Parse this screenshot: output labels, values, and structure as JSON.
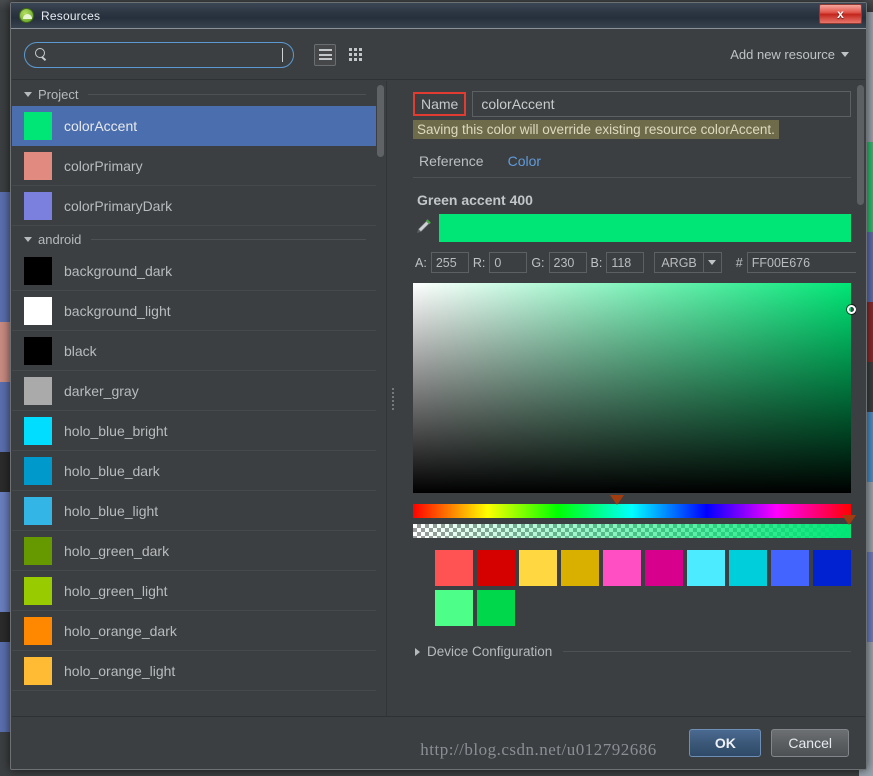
{
  "window": {
    "title": "Resources",
    "app_icon": "android-studio-icon",
    "close_label": "x"
  },
  "toolbar": {
    "search_value": "",
    "search_placeholder": "",
    "list_view_label": "list-view",
    "grid_view_label": "grid-view",
    "add_resource_label": "Add new resource"
  },
  "left_pane": {
    "groups": [
      {
        "title": "Project",
        "items": [
          {
            "label": "colorAccent",
            "color": "#00E676",
            "selected": true
          },
          {
            "label": "colorPrimary",
            "color": "#E08A80",
            "selected": false
          },
          {
            "label": "colorPrimaryDark",
            "color": "#7B7FDD",
            "selected": false
          }
        ]
      },
      {
        "title": "android",
        "items": [
          {
            "label": "background_dark",
            "color": "#000000",
            "selected": false
          },
          {
            "label": "background_light",
            "color": "#FFFFFF",
            "selected": false
          },
          {
            "label": "black",
            "color": "#000000",
            "selected": false
          },
          {
            "label": "darker_gray",
            "color": "#AAAAAA",
            "selected": false
          },
          {
            "label": "holo_blue_bright",
            "color": "#00DDFF",
            "selected": false
          },
          {
            "label": "holo_blue_dark",
            "color": "#0099CC",
            "selected": false
          },
          {
            "label": "holo_blue_light",
            "color": "#33B5E5",
            "selected": false
          },
          {
            "label": "holo_green_dark",
            "color": "#669900",
            "selected": false
          },
          {
            "label": "holo_green_light",
            "color": "#99CC00",
            "selected": false
          },
          {
            "label": "holo_orange_dark",
            "color": "#FF8800",
            "selected": false
          },
          {
            "label": "holo_orange_light",
            "color": "#FFBB33",
            "selected": false
          }
        ]
      }
    ]
  },
  "right_pane": {
    "name_label": "Name",
    "name_value": "colorAccent",
    "warning": "Saving this color will override existing resource colorAccent.",
    "tabs": [
      {
        "label": "Reference",
        "active": false
      },
      {
        "label": "Color",
        "active": true
      }
    ],
    "color_title": "Green accent 400",
    "pipette_icon": "eyedropper-icon",
    "preview_color": "#00E676",
    "channels": {
      "a_label": "A:",
      "a_value": "255",
      "r_label": "R:",
      "r_value": "0",
      "g_label": "G:",
      "g_value": "230",
      "b_label": "B:",
      "b_value": "118",
      "mode_value": "ARGB",
      "hash_label": "#",
      "hex_value": "FF00E676"
    },
    "sliders": {
      "hue_position_pct": 46.5,
      "alpha_position_pct": 99.5
    },
    "palette": [
      [
        "#FF5252",
        "#D50000",
        "#FFD740",
        "#D9AF00",
        "#FF4FC3",
        "#D6008C",
        "#4DEBFF",
        "#00CEDB",
        "#4364FF",
        "#0022D1"
      ],
      [
        "#4DFF88",
        "#00D74A"
      ]
    ],
    "device_configuration_label": "Device Configuration"
  },
  "footer": {
    "ok_label": "OK",
    "cancel_label": "Cancel"
  },
  "watermark": "http://blog.csdn.net/u012792686"
}
